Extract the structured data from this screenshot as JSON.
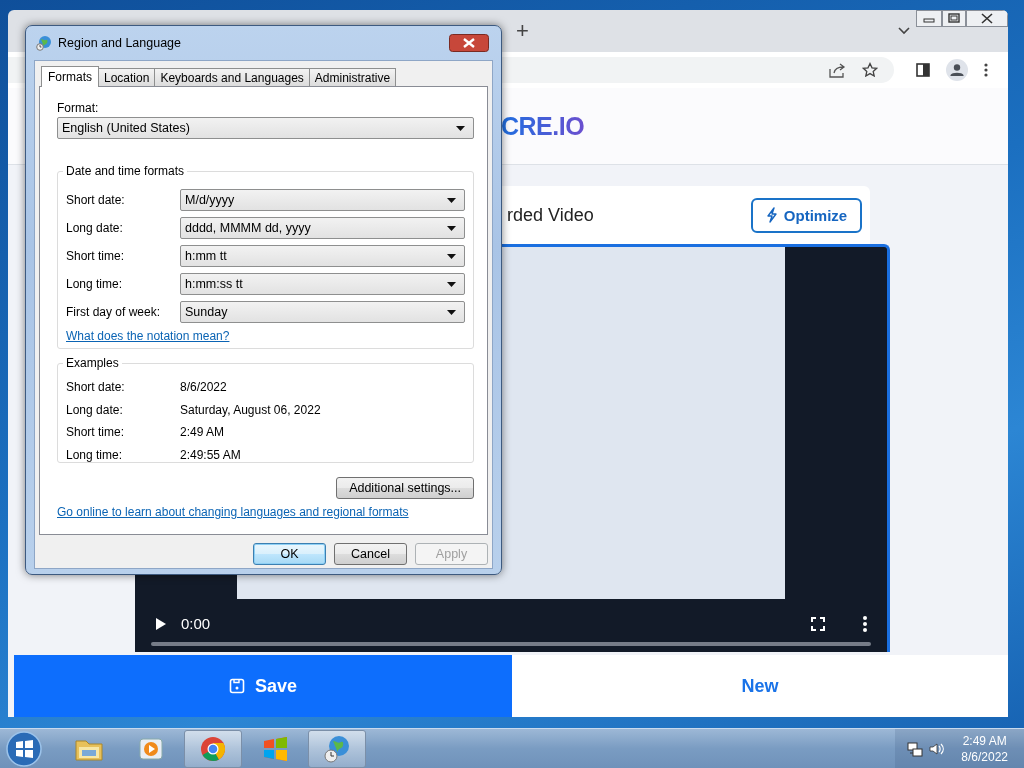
{
  "browser": {
    "new_tab_button": "+",
    "logo_text": "CRE.IO",
    "card_title": "rded Video",
    "optimize_button": "Optimize",
    "video": {
      "time": "0:00"
    },
    "save_button": "Save",
    "new_button": "New"
  },
  "dialog": {
    "title": "Region and Language",
    "tabs": [
      {
        "label": "Formats",
        "selected": true
      },
      {
        "label": "Location",
        "selected": false
      },
      {
        "label": "Keyboards and Languages",
        "selected": false
      },
      {
        "label": "Administrative",
        "selected": false
      }
    ],
    "format_label": "Format:",
    "format_value": "English (United States)",
    "date_time_group": {
      "title": "Date and time formats",
      "rows": [
        {
          "label": "Short date:",
          "value": "M/d/yyyy"
        },
        {
          "label": "Long date:",
          "value": "dddd, MMMM dd, yyyy"
        },
        {
          "label": "Short time:",
          "value": "h:mm tt"
        },
        {
          "label": "Long time:",
          "value": "h:mm:ss tt"
        },
        {
          "label": "First day of week:",
          "value": "Sunday"
        }
      ]
    },
    "notation_link": "What does the notation mean?",
    "examples_group": {
      "title": "Examples",
      "rows": [
        {
          "label": "Short date:",
          "value": "8/6/2022"
        },
        {
          "label": "Long date:",
          "value": "Saturday, August 06, 2022"
        },
        {
          "label": "Short time:",
          "value": "2:49 AM"
        },
        {
          "label": "Long time:",
          "value": "2:49:55 AM"
        }
      ]
    },
    "additional_settings_button": "Additional settings...",
    "online_link": "Go online to learn about changing languages and regional formats",
    "buttons": [
      {
        "label": "OK",
        "default": true,
        "disabled": false
      },
      {
        "label": "Cancel",
        "default": false,
        "disabled": false
      },
      {
        "label": "Apply",
        "default": false,
        "disabled": true
      }
    ]
  },
  "taskbar": {
    "apps": [
      {
        "selected": false
      },
      {
        "selected": false
      },
      {
        "selected": true
      },
      {
        "selected": false
      },
      {
        "selected": true
      }
    ],
    "time": "2:49 AM",
    "date": "8/6/2022"
  }
}
